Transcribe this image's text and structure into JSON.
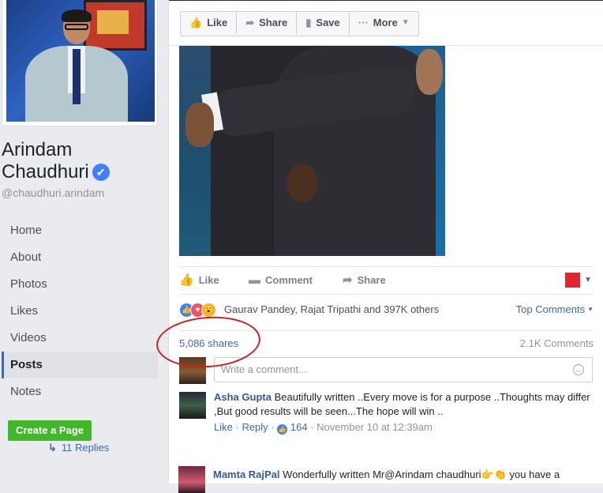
{
  "profile": {
    "name_line1": "Arindam",
    "name_line2": "Chaudhuri",
    "verified_icon": "✔",
    "username": "@chaudhuri.arindam"
  },
  "nav": {
    "items": [
      {
        "label": "Home"
      },
      {
        "label": "About"
      },
      {
        "label": "Photos"
      },
      {
        "label": "Likes"
      },
      {
        "label": "Videos"
      },
      {
        "label": "Posts",
        "active": true
      },
      {
        "label": "Notes"
      }
    ],
    "create_page": "Create a Page"
  },
  "toolbar": {
    "like": "Like",
    "share": "Share",
    "save": "Save",
    "more": "More",
    "icons": {
      "like": "thumbs-up-icon",
      "share": "share-arrow-icon",
      "save": "bookmark-icon",
      "more": "ellipsis-icon"
    }
  },
  "post": {
    "actions": {
      "like": "Like",
      "comment": "Comment",
      "share": "Share"
    },
    "reaction_names": "Gaurav Pandey, Rajat Tripathi and 397K others",
    "top_comments": "Top Comments",
    "shares": "5,086 shares",
    "comment_count": "2.1K Comments",
    "comment_placeholder": "Write a comment...",
    "colors": {
      "link": "#4267b2",
      "like_blue": "#4080ff",
      "love_red": "#f25268",
      "highlight": "#c8211e"
    }
  },
  "comments": [
    {
      "author": "Asha Gupta",
      "text": " Beautifully written ..Every move is for a purpose ..Thoughts may differ ,But good results will be seen...The hope will win ..",
      "like": "Like",
      "reply": "Reply",
      "likes": "164",
      "time": "November 10 at 12:39am",
      "replies": "11 Replies"
    },
    {
      "author": "Mamta RajPal",
      "text": " Wonderfully written Mr@Arindam chaudhuri👉👏 you have a"
    }
  ]
}
